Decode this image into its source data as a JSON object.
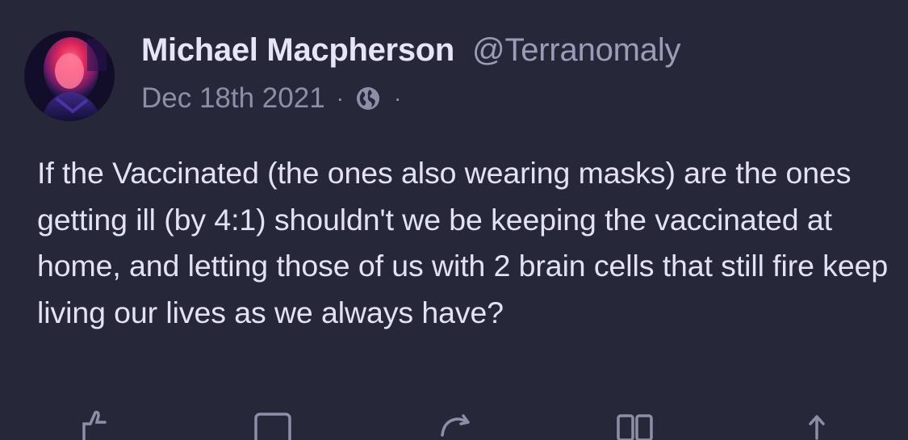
{
  "post": {
    "author": {
      "display_name": "Michael Macpherson",
      "handle": "@Terranomaly"
    },
    "date": "Dec 18th 2021",
    "meta_separator": "·",
    "visibility_icon": "globe-icon",
    "text": "If the Vaccinated (the ones also wearing masks) are the ones getting ill (by 4:1) shouldn't we be keeping the vaccinated at home, and letting those of us with 2 brain cells that still fire keep living our lives as we always have?"
  },
  "actions": [
    {
      "icon": "like-icon"
    },
    {
      "icon": "comment-icon"
    },
    {
      "icon": "repost-icon"
    },
    {
      "icon": "bookmark-icon"
    },
    {
      "icon": "share-icon"
    }
  ],
  "colors": {
    "background": "#262839",
    "primary_text": "#e3e2f5",
    "secondary_text": "#8e8ea8"
  }
}
